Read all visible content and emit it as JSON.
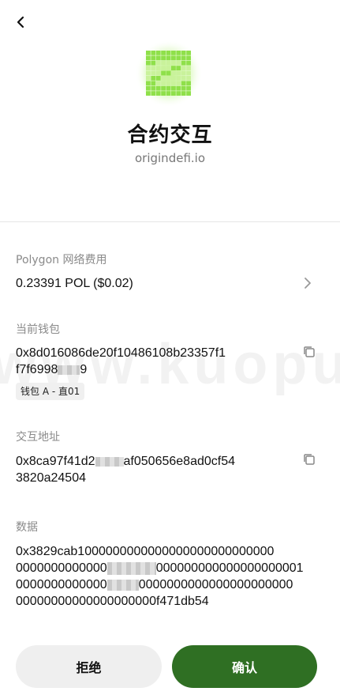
{
  "header": {
    "back_icon": "chevron-left-icon",
    "logo_icon": "origin-defi-pixel-logo",
    "title": "合约交互",
    "domain": "origindefi.io"
  },
  "fee": {
    "label": "Polygon 网络费用",
    "value": "0.23391 POL ($0.02)",
    "chevron_icon": "chevron-right-icon"
  },
  "wallet": {
    "label": "当前钱包",
    "address_line1": "0x8d016086de20f10486108b23357f1",
    "address_line2_prefix": "f7f6998",
    "address_line2_suffix": "9",
    "tag": "钱包 A - 直01",
    "copy_icon": "copy-icon"
  },
  "interaction": {
    "label": "交互地址",
    "address_prefix": "0x8ca97f41d2",
    "address_suffix": "af050656e8ad0cf54",
    "address_line2": "3820a24504",
    "copy_icon": "copy-icon"
  },
  "data": {
    "label": "数据",
    "line1": "0x3829cab1000000000000000000000000000",
    "line2_prefix": "0000000000000",
    "line2_suffix": "000000000000000000001",
    "line3_prefix": "0000000000000",
    "line3_suffix": "0000000000000000000000",
    "line4": "00000000000000000000f471db54"
  },
  "actions": {
    "reject": "拒绝",
    "confirm": "确认"
  },
  "colors": {
    "confirm_bg": "#2f6f23",
    "logo_green": "#8fe04a"
  },
  "watermark": "www.kuopuu.co"
}
